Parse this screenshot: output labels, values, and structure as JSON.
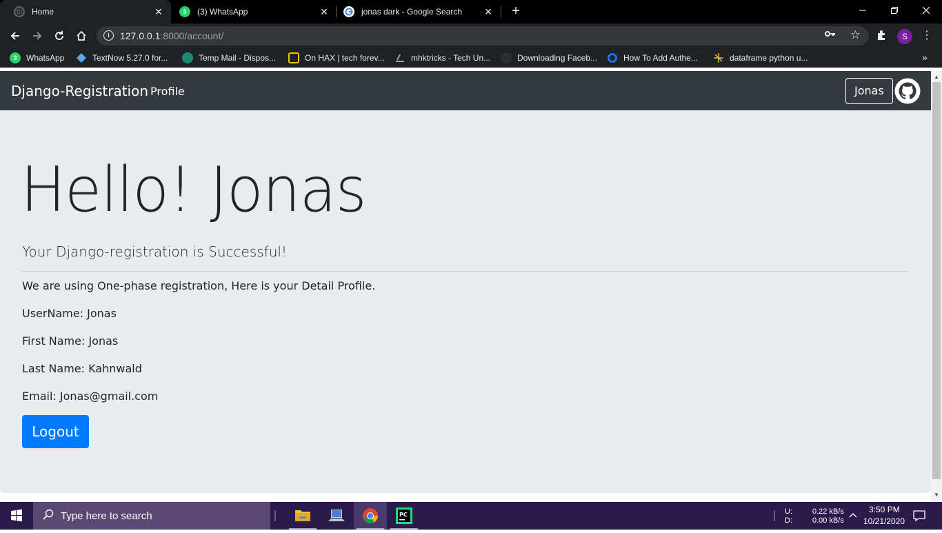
{
  "browser": {
    "tabs": [
      {
        "title": "Home",
        "favicon": "globe-icon",
        "active": true
      },
      {
        "title": "(3) WhatsApp",
        "favicon": "whatsapp-icon",
        "badge": "3",
        "active": false
      },
      {
        "title": "jonas dark - Google Search",
        "favicon": "google-icon",
        "active": false
      }
    ],
    "new_tab_glyph": "+",
    "close_glyph": "✕",
    "url_host": "127.0.0.1",
    "url_rest": ":8000/account/",
    "profile_initial": "S",
    "bookmarks": [
      {
        "label": "WhatsApp",
        "icon": "whatsapp-icon",
        "badge": "3"
      },
      {
        "label": "TextNow 5.27.0 for...",
        "icon": "textnow-icon"
      },
      {
        "label": "Temp Mail - Dispos...",
        "icon": "tempmail-icon"
      },
      {
        "label": "On HAX | tech forev...",
        "icon": "onhax-icon"
      },
      {
        "label": "mhktricks - Tech Un...",
        "icon": "mhktricks-icon"
      },
      {
        "label": "Downloading Faceb...",
        "icon": "facebook-icon"
      },
      {
        "label": "How To Add Authe...",
        "icon": "howto-icon"
      },
      {
        "label": "dataframe python u...",
        "icon": "dataframe-icon"
      }
    ]
  },
  "site": {
    "brand": "Django-Registration",
    "nav_profile": "Profile",
    "user_button": "Jonas",
    "heading": "Hello! Jonas",
    "lead": "Your Django-registration is Successful!",
    "intro": "We are using One-phase registration, Here is your Detail Profile.",
    "username": "UserName: Jonas",
    "first_name": "First Name: Jonas",
    "last_name": "Last Name: Kahnwald",
    "email": "Email: Jonas@gmail.com",
    "logout": "Logout"
  },
  "taskbar": {
    "search_placeholder": "Type here to search",
    "upload_label": "U:",
    "download_label": "D:",
    "upload_rate": "0.22 kB/s",
    "download_rate": "0.00 kB/s",
    "time": "3:50 PM",
    "date": "10/21/2020",
    "apps": [
      "file-explorer-icon",
      "laptop-icon",
      "chrome-icon",
      "pycharm-icon"
    ]
  },
  "colors": {
    "navbar": "#343a40",
    "page_bg": "#e9ecef",
    "primary": "#007bff",
    "taskbar": "#2b1b4a"
  }
}
